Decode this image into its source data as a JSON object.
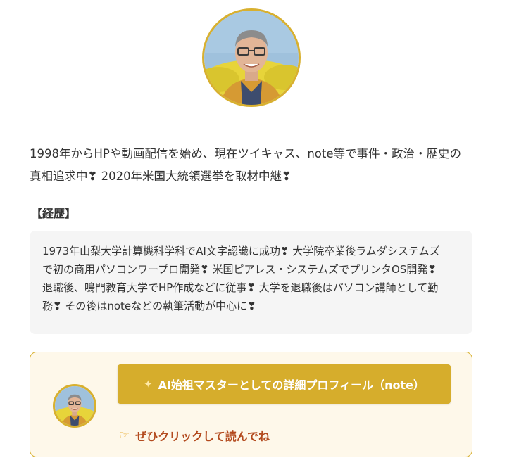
{
  "colors": {
    "accent": "#d6ad2c",
    "card_background": "#fef8ea",
    "career_background": "#f5f5f5",
    "cta_text": "#b34a1e"
  },
  "profile": {
    "avatar_icon": "person-photo"
  },
  "intro": {
    "line1": "1998年からHPや動画配信を始め、現在ツイキャス、note等で事件・政治・歴史の",
    "line2": "真相追求中❣ 2020年米国大統領選挙を取材中継❣"
  },
  "career": {
    "heading": "【経歴】",
    "lines": [
      "1973年山梨大学計算機科学科でAI文字認識に成功❣ 大学院卒業後ラムダシステムズ",
      "で初の商用パソコンワープロ開発❣ 米国ピアレス・システムズでプリンタOS開発❣",
      "退職後、鳴門教育大学でHP作成などに従事❣ 大学を退職後はパソコン講師として勤",
      "務❣ その後はnoteなどの執筆活動が中心に❣"
    ]
  },
  "profile_card": {
    "button_icon": "sparkle-icon",
    "button_label": "AI始祖マスターとしての詳細プロフィール（note）",
    "cta_icon": "pointing-hand-icon",
    "cta_label": "ぜひクリックして読んでね"
  }
}
